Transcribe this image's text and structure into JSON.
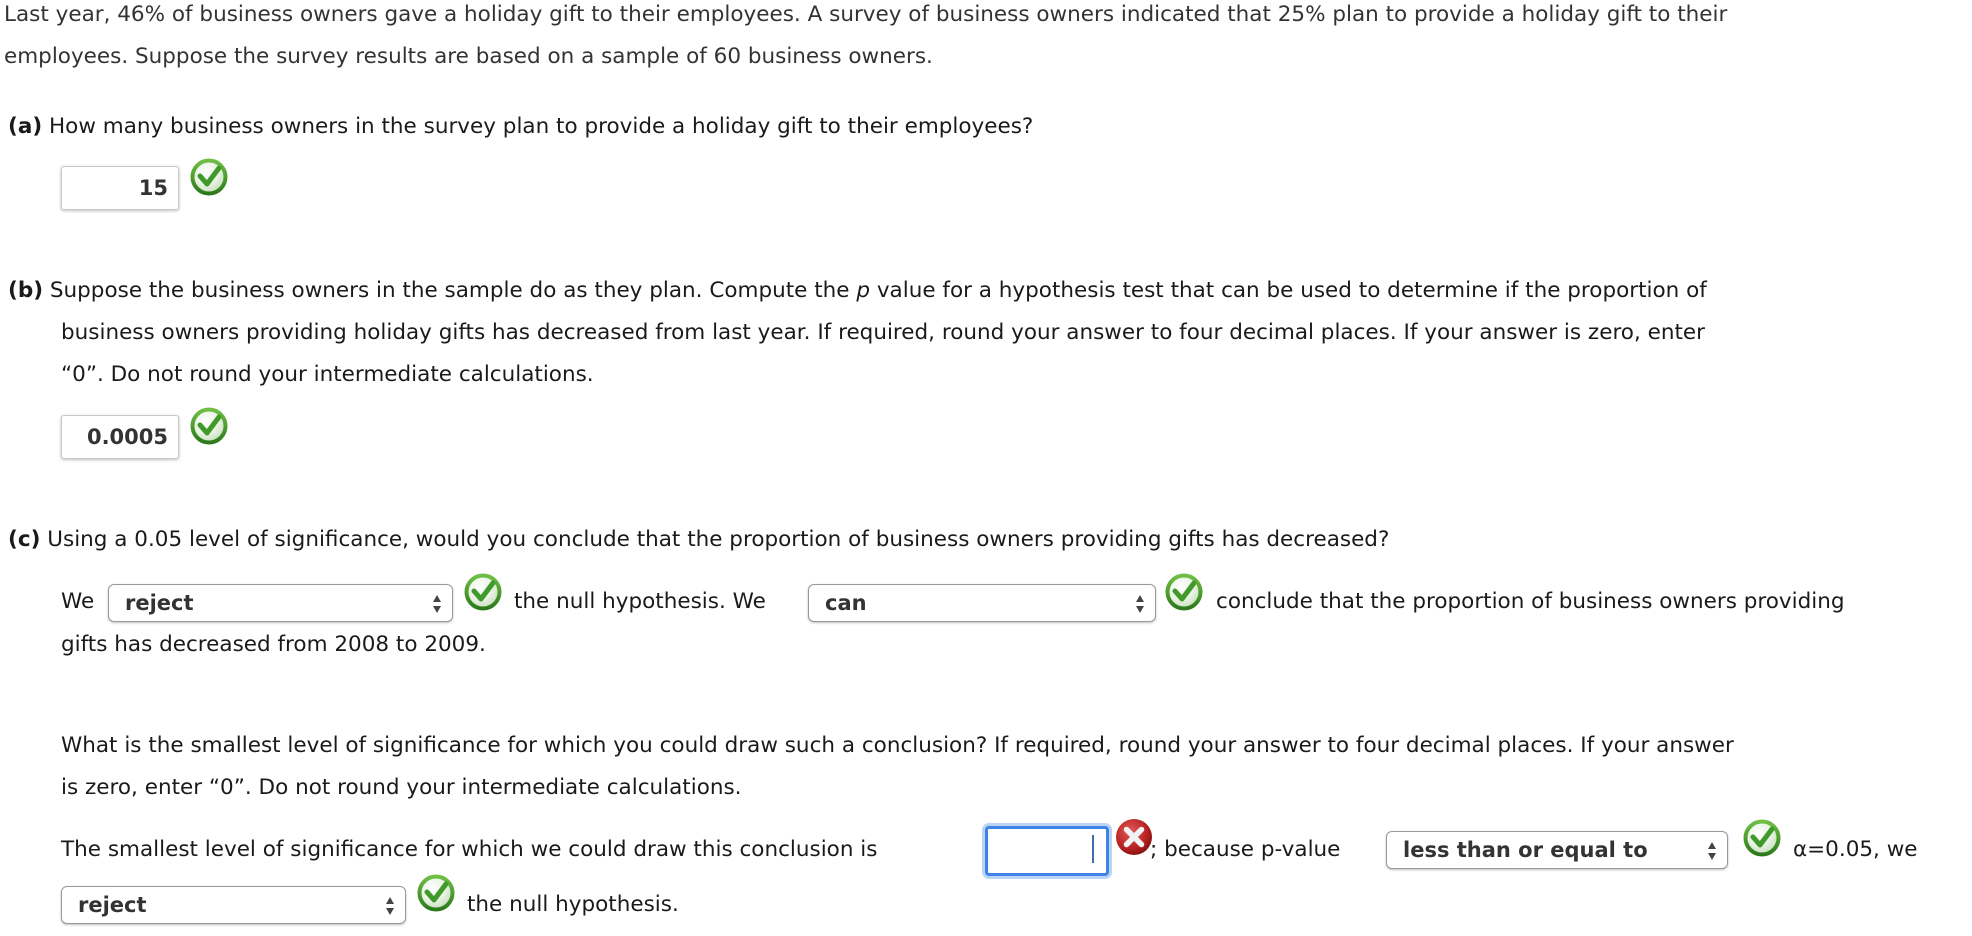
{
  "intro": {
    "line1": "Last year, 46% of business owners gave a holiday gift to their employees. A survey of business owners indicated that 25% plan to provide a holiday gift to their",
    "line2": "employees. Suppose the survey results are based on a sample of 60 business owners."
  },
  "part_a": {
    "label": "(a)",
    "question": "How many business owners in the survey plan to provide a holiday gift to their employees?",
    "answer_value": "15",
    "status_icon": "check-icon"
  },
  "part_b": {
    "label": "(b)",
    "line1_pre": "Suppose the business owners in the sample do as they plan. Compute the ",
    "line1_italic": "p",
    "line1_post": " value for a hypothesis test that can be used to determine if the proportion of",
    "line2": "business owners providing holiday gifts has decreased from last year. If required, round your answer to four decimal places. If your answer is zero, enter",
    "line3": "“0”. Do not round your intermediate calculations.",
    "answer_value": "0.0005",
    "status_icon": "check-icon"
  },
  "part_c": {
    "label": "(c)",
    "question": "Using a 0.05 level of significance, would you conclude that the proportion of business owners providing gifts has decreased?",
    "sentence": {
      "we_1": "We",
      "select_1": "reject",
      "mid": "the null hypothesis. We",
      "select_2": "can",
      "tail": "conclude that the proportion of business owners providing",
      "line2": "gifts has decreased from 2008 to 2009."
    },
    "followup": {
      "line1": "What is the smallest level of significance for which you could draw such a conclusion? If required, round your answer to four decimal places. If your answer",
      "line2": "is zero, enter “0”. Do not round your intermediate calculations."
    },
    "conclusion": {
      "pre": "The smallest level of significance for which we could draw this conclusion is",
      "answer_value": "",
      "answer_status_icon": "x-icon",
      "because": "; because p-value",
      "comparison_select": "less than or equal to",
      "alpha_text": "α=0.05, we",
      "decision_select": "reject",
      "end": "the null hypothesis."
    }
  },
  "colors": {
    "correct": "#3f9a2a",
    "incorrect": "#c62828",
    "focus": "#3d84e6"
  }
}
